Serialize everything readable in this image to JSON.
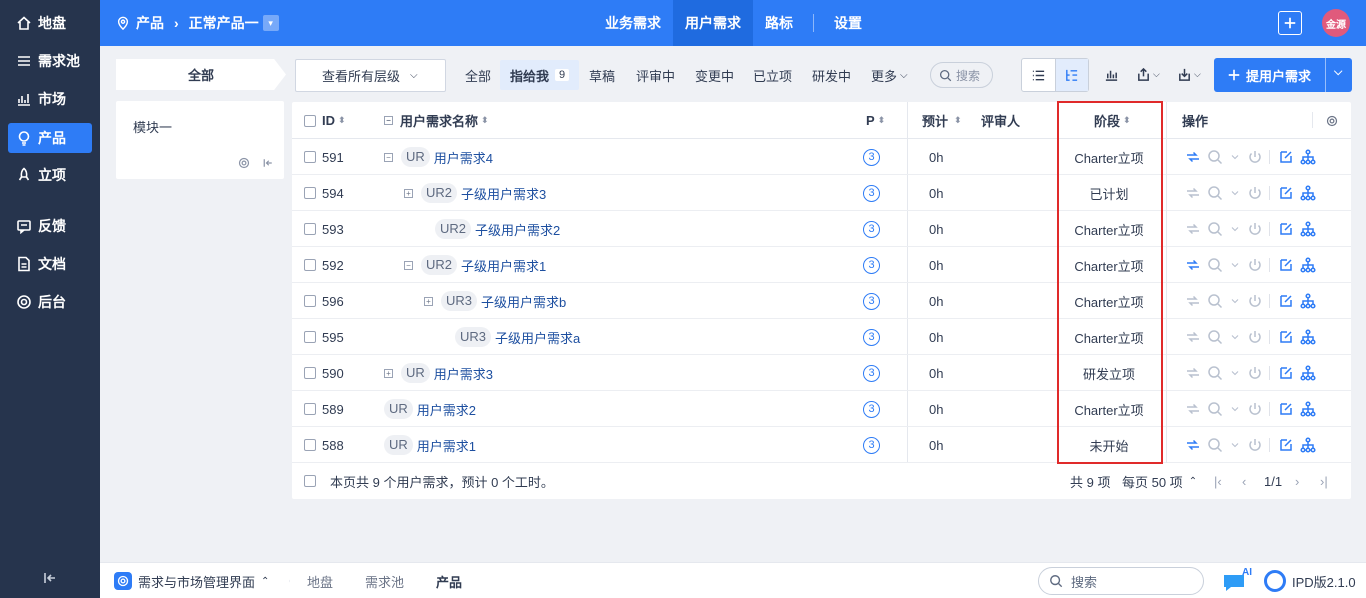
{
  "sidebar": {
    "items": [
      {
        "label": "地盘",
        "icon": "home-icon"
      },
      {
        "label": "需求池",
        "icon": "list-icon"
      },
      {
        "label": "市场",
        "icon": "chart-icon"
      },
      {
        "label": "产品",
        "icon": "bulb-icon",
        "active": true
      },
      {
        "label": "立项",
        "icon": "rocket-icon"
      },
      {
        "label": "反馈",
        "icon": "feedback-icon"
      },
      {
        "label": "文档",
        "icon": "document-icon"
      },
      {
        "label": "后台",
        "icon": "gear-icon"
      }
    ]
  },
  "header": {
    "crumb_product": "产品",
    "crumb_current": "正常产品一",
    "nav": [
      "业务需求",
      "用户需求",
      "路标",
      "设置"
    ],
    "active_nav": "用户需求",
    "avatar": "金源"
  },
  "left_panel": {
    "all_label": "全部",
    "module": "模块一"
  },
  "toolbar": {
    "level_select": "查看所有层级",
    "tabs": [
      "全部",
      "指给我",
      "草稿",
      "评审中",
      "变更中",
      "已立项",
      "研发中",
      "更多"
    ],
    "active_tab": "指给我",
    "assigned_count": "9",
    "search": "搜索",
    "add_button": "提用户需求"
  },
  "table": {
    "columns": {
      "id": "ID",
      "name": "用户需求名称",
      "priority": "P",
      "estimate": "预计",
      "reviewer": "评审人",
      "stage": "阶段",
      "actions": "操作"
    },
    "rows": [
      {
        "id": "591",
        "tag": "UR",
        "name": "用户需求4",
        "pri": "3",
        "est": "0h",
        "stage": "Charter立项",
        "expander": "−",
        "level": 0,
        "ops_active": true
      },
      {
        "id": "594",
        "tag": "UR2",
        "name": "子级用户需求3",
        "pri": "3",
        "est": "0h",
        "stage": "已计划",
        "expander": "+",
        "level": 1,
        "ops_active": false
      },
      {
        "id": "593",
        "tag": "UR2",
        "name": "子级用户需求2",
        "pri": "3",
        "est": "0h",
        "stage": "Charter立项",
        "expander": "",
        "level": 1,
        "ops_active": false
      },
      {
        "id": "592",
        "tag": "UR2",
        "name": "子级用户需求1",
        "pri": "3",
        "est": "0h",
        "stage": "Charter立项",
        "expander": "−",
        "level": 1,
        "ops_active": true
      },
      {
        "id": "596",
        "tag": "UR3",
        "name": "子级用户需求b",
        "pri": "3",
        "est": "0h",
        "stage": "Charter立项",
        "expander": "+",
        "level": 2,
        "ops_active": false
      },
      {
        "id": "595",
        "tag": "UR3",
        "name": "子级用户需求a",
        "pri": "3",
        "est": "0h",
        "stage": "Charter立项",
        "expander": "",
        "level": 2,
        "ops_active": false
      },
      {
        "id": "590",
        "tag": "UR",
        "name": "用户需求3",
        "pri": "3",
        "est": "0h",
        "stage": "研发立项",
        "expander": "+",
        "level": 0,
        "ops_active": false
      },
      {
        "id": "589",
        "tag": "UR",
        "name": "用户需求2",
        "pri": "3",
        "est": "0h",
        "stage": "Charter立项",
        "expander": "",
        "level": 0,
        "ops_active": false
      },
      {
        "id": "588",
        "tag": "UR",
        "name": "用户需求1",
        "pri": "3",
        "est": "0h",
        "stage": "未开始",
        "expander": "",
        "level": 0,
        "ops_active": true
      }
    ],
    "footer_summary": "本页共 9 个用户需求，预计 0 个工时。",
    "total": "共 9 项",
    "per_page": "每页 50 项",
    "page": "1/1"
  },
  "bottom": {
    "app_switch": "需求与市场管理界面",
    "crumbs": [
      "地盘",
      "需求池",
      "产品"
    ],
    "search": "搜索",
    "version": "IPD版2.1.0",
    "ai_label": "AI"
  },
  "colors": {
    "sidebar": "#26344d",
    "primary": "#2e7cf6",
    "highlight": "#e02a2a"
  }
}
